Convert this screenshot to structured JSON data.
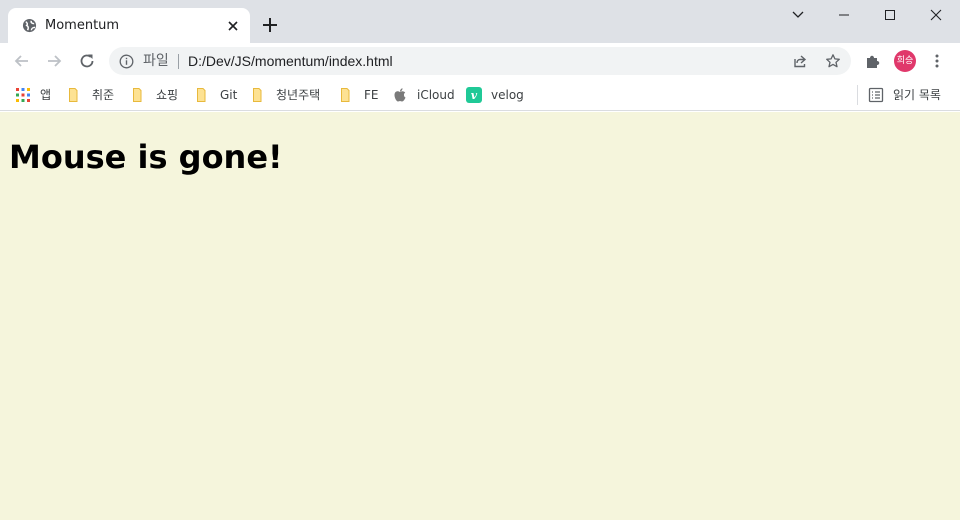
{
  "browser": {
    "tab": {
      "title": "Momentum"
    },
    "address_bar": {
      "scheme_label": "파일",
      "url": "D:/Dev/JS/momentum/index.html"
    },
    "profile": {
      "initials": "희승",
      "color": "#e0386b"
    }
  },
  "bookmarks": [
    {
      "label": "앱",
      "icon": "apps-grid-icon"
    },
    {
      "label": "취준",
      "icon": "folder-icon"
    },
    {
      "label": "쇼핑",
      "icon": "folder-icon"
    },
    {
      "label": "Git",
      "icon": "folder-icon"
    },
    {
      "label": "청년주택",
      "icon": "folder-icon"
    },
    {
      "label": "FE",
      "icon": "folder-icon"
    },
    {
      "label": "iCloud",
      "icon": "apple-icon"
    },
    {
      "label": "velog",
      "icon": "velog-icon"
    }
  ],
  "reading_list": {
    "label": "읽기 목록"
  },
  "page": {
    "heading": "Mouse is gone!",
    "background": "#f5f5dc"
  }
}
